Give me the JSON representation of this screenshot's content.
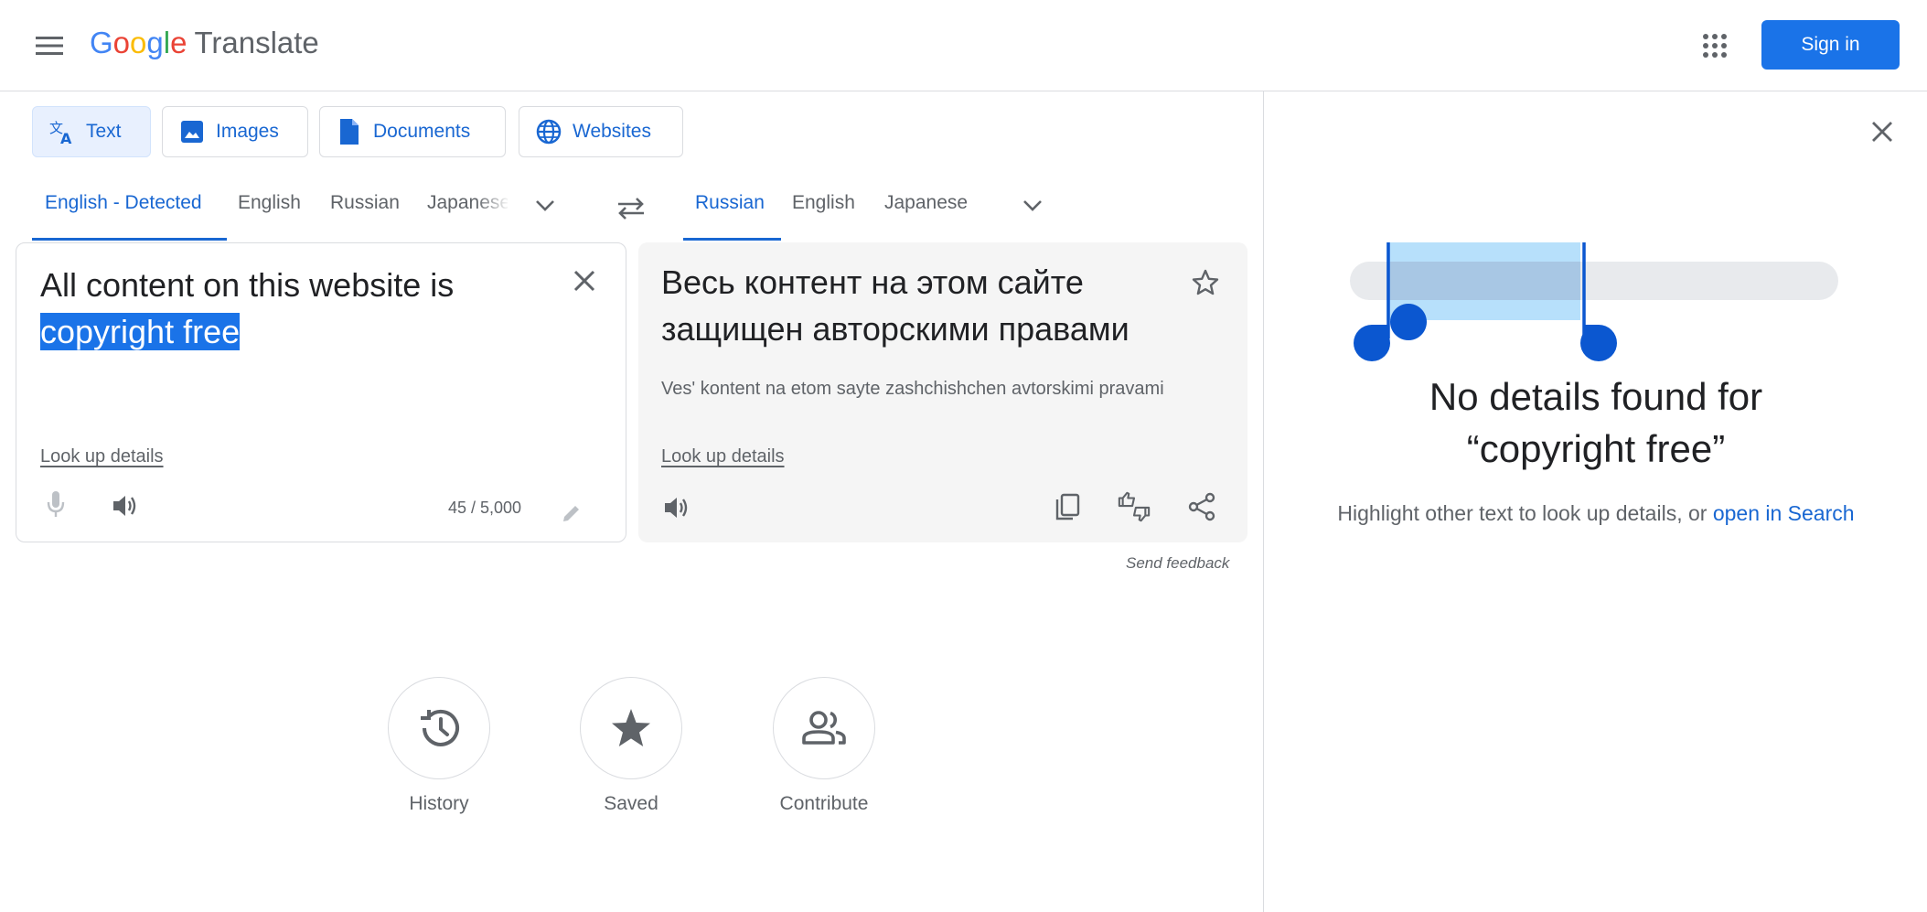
{
  "header": {
    "logo_letters": [
      "G",
      "o",
      "o",
      "g",
      "l",
      "e"
    ],
    "product": "Translate",
    "signin_label": "Sign in"
  },
  "mode_tabs": [
    {
      "label": "Text",
      "icon": "translate-icon",
      "active": true
    },
    {
      "label": "Images",
      "icon": "image-icon",
      "active": false
    },
    {
      "label": "Documents",
      "icon": "document-icon",
      "active": false
    },
    {
      "label": "Websites",
      "icon": "globe-icon",
      "active": false
    }
  ],
  "source_langs": [
    "English - Detected",
    "English",
    "Russian",
    "Japanese"
  ],
  "target_langs": [
    "Russian",
    "English",
    "Japanese"
  ],
  "source": {
    "text_plain": "All content on this website is",
    "text_selected": "copyright free",
    "lookup": "Look up details",
    "counter": "45 / 5,000"
  },
  "target": {
    "text": "Весь контент на этом сайте защищен авторскими правами",
    "transliteration": "Ves' kontent na etom sayte zashchishchen avtorskimi pravami",
    "lookup": "Look up details",
    "feedback": "Send feedback"
  },
  "bottom_actions": [
    {
      "label": "History",
      "icon": "history-icon"
    },
    {
      "label": "Saved",
      "icon": "star-filled-icon"
    },
    {
      "label": "Contribute",
      "icon": "people-icon"
    }
  ],
  "side_panel": {
    "title_line1": "No details found for",
    "title_line2": "“copyright free”",
    "hint_prefix": "Highlight other text to look up details, or ",
    "hint_link": "open in Search"
  },
  "colors": {
    "accent": "#1a73e8",
    "accent_text": "#1967d2",
    "logo_blue": "#4285f4",
    "logo_red": "#ea4335",
    "logo_yellow": "#fbbc05",
    "logo_green": "#34a853"
  }
}
